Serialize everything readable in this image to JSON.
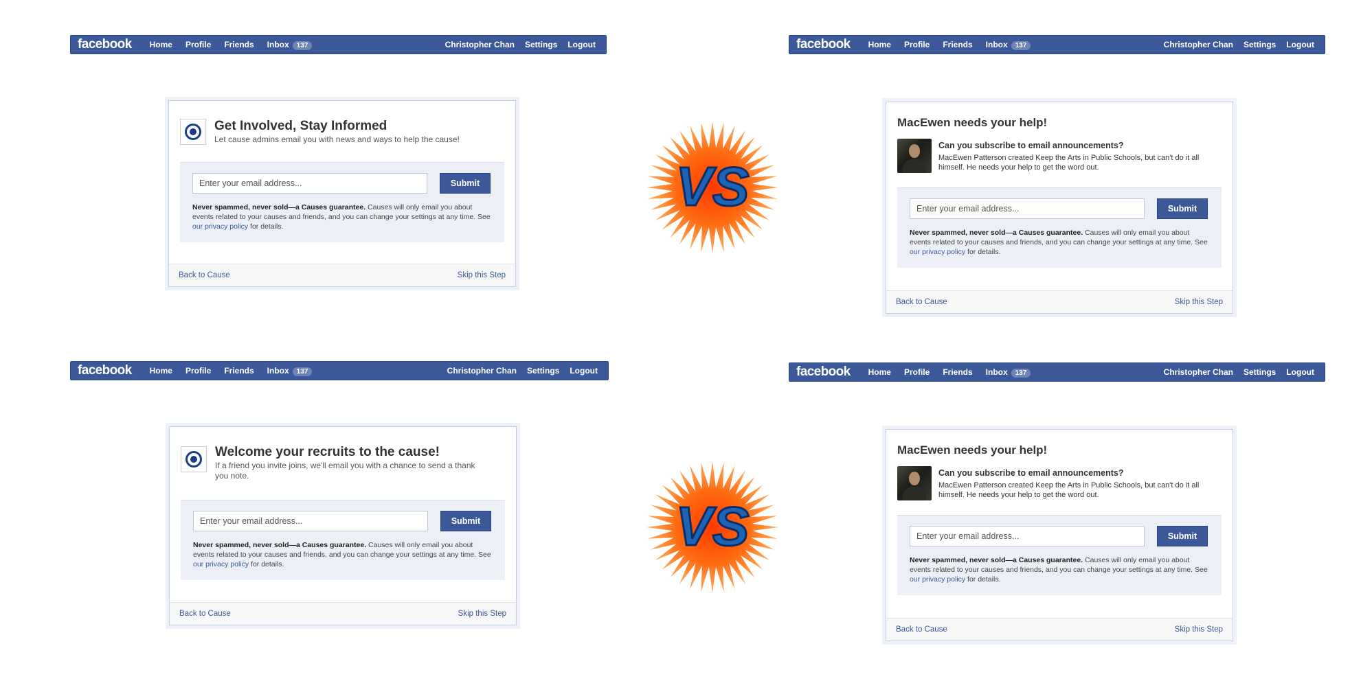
{
  "fb": {
    "logo": "facebook",
    "nav_home": "Home",
    "nav_profile": "Profile",
    "nav_friends": "Friends",
    "nav_inbox": "Inbox",
    "inbox_count": "137",
    "user_name": "Christopher Chan",
    "nav_settings": "Settings",
    "nav_logout": "Logout"
  },
  "variants": [
    {
      "title": "Get Involved, Stay Informed",
      "subtitle": "Let cause admins email you with news and ways to help the cause!"
    },
    {
      "title": "MacEwen needs your help!",
      "question": "Can you subscribe to email announcements?",
      "description": "MacEwen Patterson created Keep the Arts in Public Schools, but can't do it all himself. He needs your help to get the word out."
    },
    {
      "title": "Welcome your recruits to the cause!",
      "subtitle": "If a friend you invite joins, we'll email you with a chance to send a thank you note."
    },
    {
      "title": "MacEwen needs your help!",
      "question": "Can you subscribe to email announcements?",
      "description": "MacEwen Patterson created Keep the Arts in Public Schools, but can't do it all himself. He needs your help to get the word out."
    }
  ],
  "form": {
    "email_placeholder": "Enter your email address...",
    "submit_label": "Submit",
    "guarantee_bold": "Never spammed, never sold—a Causes guarantee.",
    "guarantee_text": " Causes will only email you about events related to your causes and friends, and you can change your settings at any time. See ",
    "privacy_link": "our privacy policy",
    "guarantee_end": " for details.",
    "back_link": "Back to Cause",
    "skip_link": "Skip this Step"
  },
  "vs_label": "VS",
  "colors": {
    "fb_blue": "#3b5998",
    "vs_orange": "#ff5a00",
    "vs_text": "#1f63b5"
  }
}
